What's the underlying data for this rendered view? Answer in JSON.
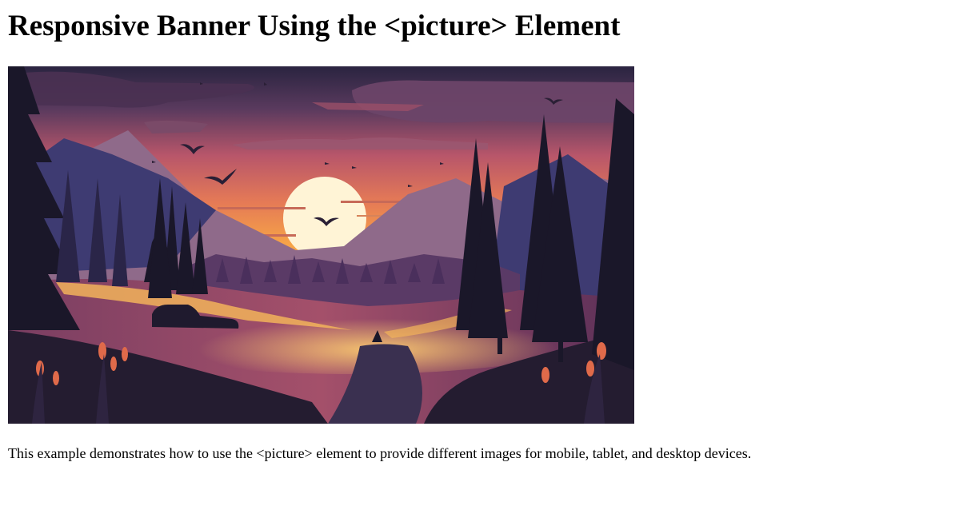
{
  "page": {
    "title": "Responsive Banner Using the <picture> Element",
    "description": "This example demonstrates how to use the <picture> element to provide different images for mobile, tablet, and desktop devices."
  },
  "banner": {
    "icon": "landscape-image"
  },
  "colors": {
    "sky_top": "#2a2440",
    "sky_mid": "#d9705a",
    "sky_horizon": "#f5a84a",
    "sun": "#fff6d8",
    "mountain_far": "#8b6a8a",
    "mountain_near": "#3d3a6e",
    "forest_dark": "#1a1729",
    "meadow": "#6a3a5c",
    "glow": "#f0b050"
  }
}
